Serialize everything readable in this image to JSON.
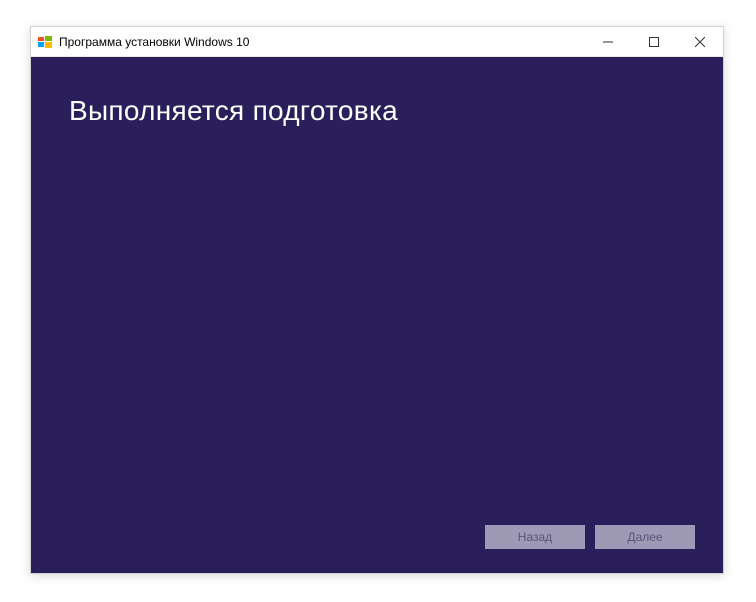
{
  "window": {
    "title": "Программа установки Windows 10"
  },
  "main": {
    "heading": "Выполняется подготовка"
  },
  "buttons": {
    "back": "Назад",
    "next": "Далее"
  }
}
